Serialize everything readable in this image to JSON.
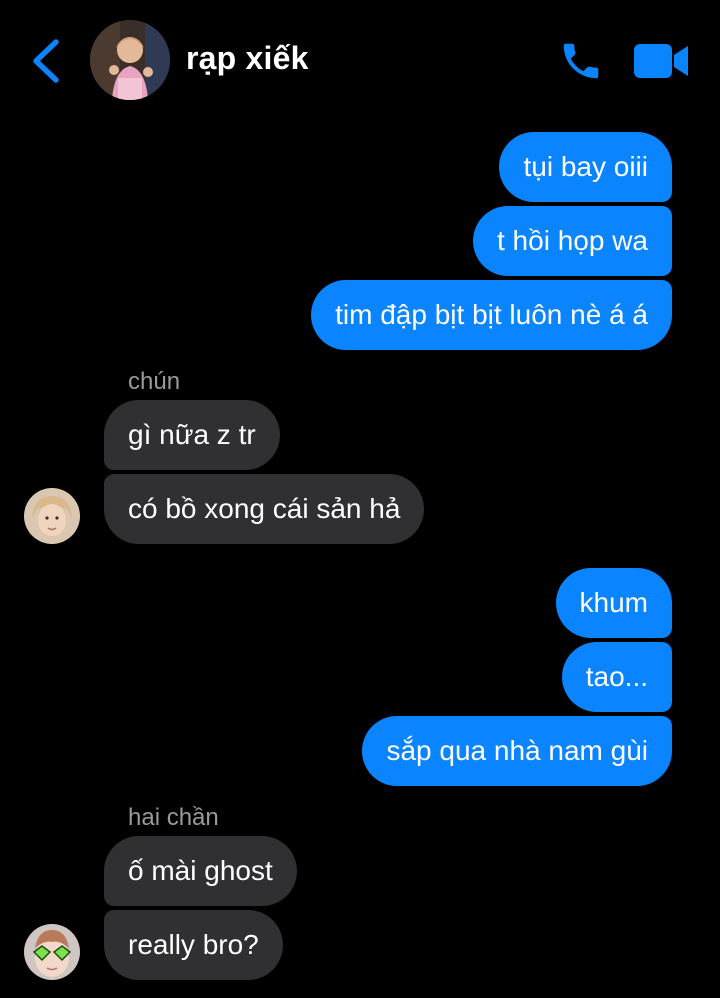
{
  "header": {
    "title": "rạp xiếk",
    "back_icon": "chevron-left-icon",
    "call_icon": "phone-icon",
    "video_icon": "video-camera-icon",
    "accent_color": "#0a84ff"
  },
  "messages": [
    {
      "direction": "outgoing",
      "text": "tụi bay oiii"
    },
    {
      "direction": "outgoing",
      "text": "t hồi họp wa"
    },
    {
      "direction": "outgoing",
      "text": "tim đập bịt bịt luôn nè á á"
    },
    {
      "direction": "incoming",
      "sender": "chún",
      "text": "gì nữa z tr"
    },
    {
      "direction": "incoming",
      "text": "có bồ xong cái sản hả"
    },
    {
      "direction": "outgoing",
      "text": "khum"
    },
    {
      "direction": "outgoing",
      "text": "tao..."
    },
    {
      "direction": "outgoing",
      "text": "sắp qua nhà nam gùi"
    },
    {
      "direction": "incoming",
      "sender": "hai chần",
      "text": "ố mài ghost"
    },
    {
      "direction": "incoming",
      "text": "really bro?"
    }
  ],
  "colors": {
    "background": "#000000",
    "outgoing_bubble": "#0a84ff",
    "incoming_bubble": "#303032",
    "sender_name": "#9a9a9e"
  }
}
